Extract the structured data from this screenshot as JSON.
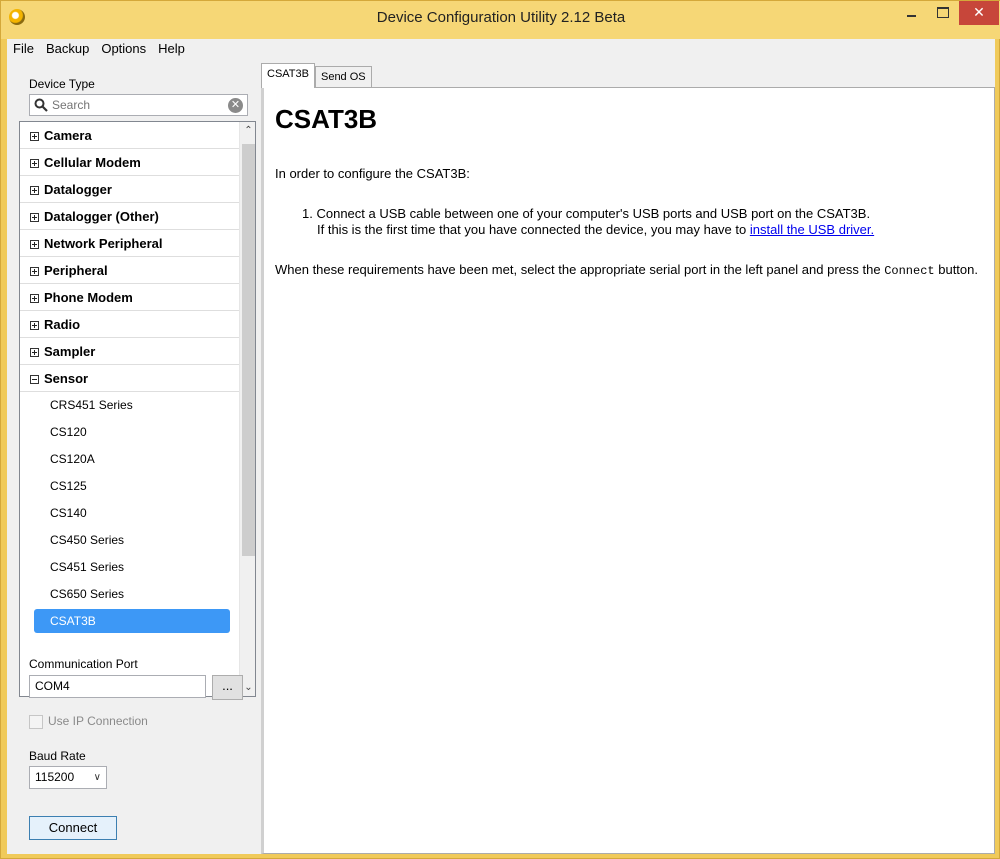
{
  "window": {
    "title": "Device Configuration Utility 2.12 Beta"
  },
  "menu": [
    "File",
    "Backup",
    "Options",
    "Help"
  ],
  "left": {
    "device_type_label": "Device Type",
    "search_placeholder": "Search",
    "categories": [
      {
        "label": "Camera",
        "expanded": false
      },
      {
        "label": "Cellular Modem",
        "expanded": false
      },
      {
        "label": "Datalogger",
        "expanded": false
      },
      {
        "label": "Datalogger (Other)",
        "expanded": false
      },
      {
        "label": "Network Peripheral",
        "expanded": false
      },
      {
        "label": "Peripheral",
        "expanded": false
      },
      {
        "label": "Phone Modem",
        "expanded": false
      },
      {
        "label": "Radio",
        "expanded": false
      },
      {
        "label": "Sampler",
        "expanded": false
      },
      {
        "label": "Sensor",
        "expanded": true
      }
    ],
    "sensor_items": [
      "CRS451 Series",
      "CS120",
      "CS120A",
      "CS125",
      "CS140",
      "CS450 Series",
      "CS451 Series",
      "CS650 Series",
      "CSAT3B"
    ],
    "selected_item": "CSAT3B",
    "comm_port_label": "Communication Port",
    "comm_port_value": "COM4",
    "browse_label": "...",
    "use_ip_label": "Use IP Connection",
    "baud_rate_label": "Baud Rate",
    "baud_rate_value": "115200",
    "connect_label": "Connect"
  },
  "tabs": [
    {
      "label": "CSAT3B",
      "active": true
    },
    {
      "label": "Send OS",
      "active": false
    }
  ],
  "doc": {
    "title": "CSAT3B",
    "intro": "In order to configure the CSAT3B:",
    "step_number": "1.",
    "step_line1": "Connect a USB cable between one of your computer's USB ports and USB port on the CSAT3B.",
    "step_line2_prefix": "If this is the first time that you have connected the device, you may have to ",
    "step_link": "install the USB driver.",
    "para_prefix": "When these requirements have been met, select the appropriate serial port in the left panel and press the ",
    "para_code": "Connect",
    "para_suffix": " button."
  },
  "colors": {
    "title_bar": "#f6d776",
    "selection": "#3d98f6",
    "close_button": "#c7463a",
    "link": "#0000ee"
  }
}
